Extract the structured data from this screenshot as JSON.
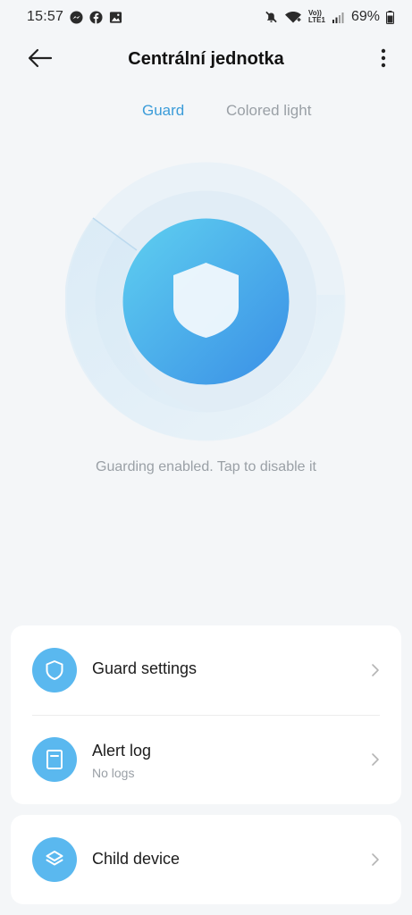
{
  "status_bar": {
    "time": "15:57",
    "battery": "69%",
    "left_icons": [
      "messenger-icon",
      "facebook-icon",
      "gallery-icon"
    ],
    "right_icons": [
      "mute-icon",
      "wifi-icon",
      "volte-icon",
      "signal-icon",
      "battery-icon"
    ],
    "volte_top": "Vo))",
    "volte_bottom": "LTE1"
  },
  "header": {
    "title": "Centrální jednotka"
  },
  "tabs": [
    {
      "label": "Guard",
      "active": true
    },
    {
      "label": "Colored light",
      "active": false
    }
  ],
  "guard": {
    "status_text": "Guarding enabled. Tap to disable it",
    "accent": "#3b9cd9"
  },
  "menu": {
    "guard_settings": {
      "title": "Guard settings"
    },
    "alert_log": {
      "title": "Alert log",
      "subtitle": "No logs"
    },
    "child_device": {
      "title": "Child device"
    }
  },
  "colors": {
    "background": "#f4f6f8",
    "icon_circle": "#5ab8ef",
    "tab_active": "#3b9cd9",
    "tab_inactive": "#9aa0a6"
  }
}
